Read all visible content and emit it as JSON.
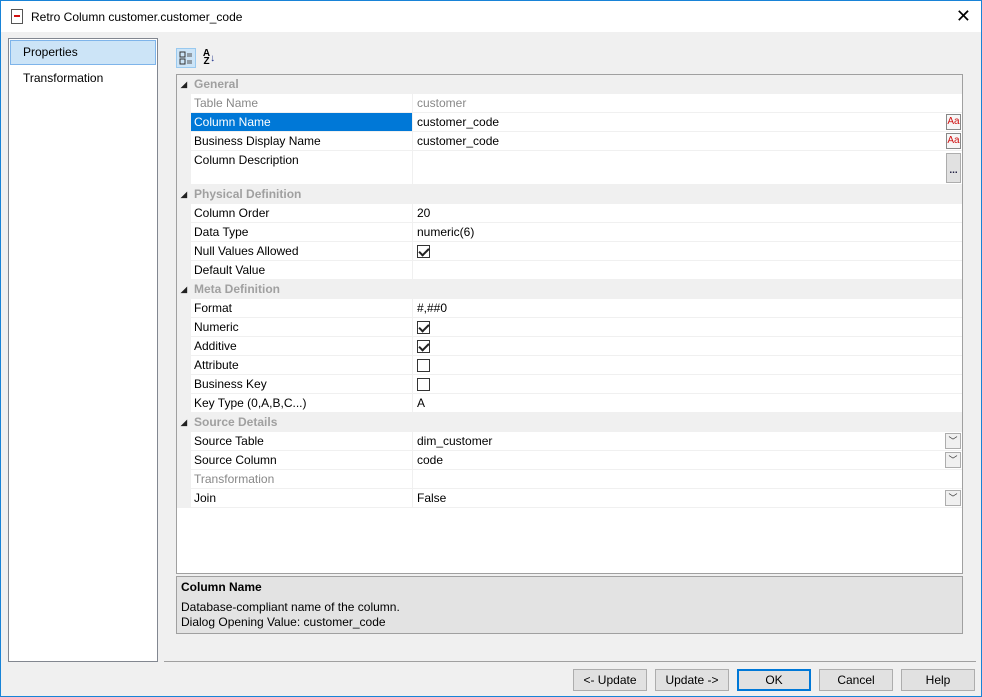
{
  "window": {
    "title": "Retro Column customer.customer_code"
  },
  "nav": [
    {
      "label": "Properties",
      "selected": true
    },
    {
      "label": "Transformation",
      "selected": false
    }
  ],
  "toolbar": {
    "categorized_label": "Categorized",
    "alpha_label": "A Z"
  },
  "grid": [
    {
      "category": "General",
      "rows": [
        {
          "name": "Table Name",
          "value": "customer",
          "readonly": true
        },
        {
          "name": "Column Name",
          "value": "customer_code",
          "selected": true,
          "editor": "aa"
        },
        {
          "name": "Business Display Name",
          "value": "customer_code",
          "editor": "aa"
        },
        {
          "name": "Column Description",
          "value": "",
          "editor": "dots",
          "tall": true
        }
      ]
    },
    {
      "category": "Physical Definition",
      "rows": [
        {
          "name": "Column Order",
          "value": "20"
        },
        {
          "name": "Data Type",
          "value": "numeric(6)"
        },
        {
          "name": "Null Values Allowed",
          "checkbox": true,
          "checked": true
        },
        {
          "name": "Default Value",
          "value": ""
        }
      ]
    },
    {
      "category": "Meta Definition",
      "rows": [
        {
          "name": "Format",
          "value": "#,##0"
        },
        {
          "name": "Numeric",
          "checkbox": true,
          "checked": true
        },
        {
          "name": "Additive",
          "checkbox": true,
          "checked": true
        },
        {
          "name": "Attribute",
          "checkbox": true,
          "checked": false
        },
        {
          "name": "Business Key",
          "checkbox": true,
          "checked": false
        },
        {
          "name": "Key Type (0,A,B,C...)",
          "value": "A"
        }
      ]
    },
    {
      "category": "Source Details",
      "rows": [
        {
          "name": "Source Table",
          "value": "dim_customer",
          "editor": "dropdown"
        },
        {
          "name": "Source Column",
          "value": "code",
          "editor": "dropdown"
        },
        {
          "name": "Transformation",
          "value": "",
          "readonly": true
        },
        {
          "name": "Join",
          "value": "False",
          "editor": "dropdown"
        }
      ]
    }
  ],
  "help": {
    "title": "Column Name",
    "line1": "Database-compliant name of the column.",
    "line2": "Dialog Opening Value: customer_code"
  },
  "buttons": {
    "prev": "<- Update",
    "next": "Update ->",
    "ok": "OK",
    "cancel": "Cancel",
    "help": "Help"
  }
}
